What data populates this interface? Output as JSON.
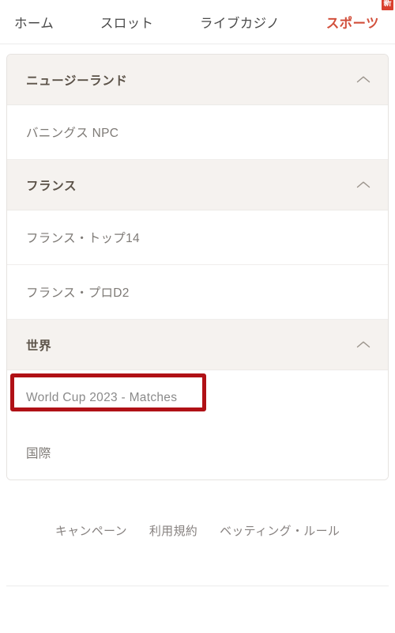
{
  "nav": {
    "items": [
      {
        "label": "ホーム",
        "active": false,
        "badge": null
      },
      {
        "label": "スロット",
        "active": false,
        "badge": null
      },
      {
        "label": "ライブカジノ",
        "active": false,
        "badge": null
      },
      {
        "label": "スポーツ",
        "active": true,
        "badge": "新"
      }
    ]
  },
  "colors": {
    "accent": "#d2503c",
    "badge": "#d9402e",
    "highlight": "#b01116",
    "header_bg": "#f5f2ef",
    "text_muted": "#7e7a76"
  },
  "sections": [
    {
      "title": "ニュージーランド",
      "toggle_icon": "chevron-up-icon",
      "leagues": [
        {
          "label": "バニングス NPC",
          "highlighted": false
        }
      ]
    },
    {
      "title": "フランス",
      "toggle_icon": "chevron-up-icon",
      "leagues": [
        {
          "label": "フランス・トップ14",
          "highlighted": false
        },
        {
          "label": "フランス・プロD2",
          "highlighted": false
        }
      ]
    },
    {
      "title": "世界",
      "toggle_icon": "chevron-up-icon",
      "leagues": [
        {
          "label": "World Cup 2023 - Matches",
          "highlighted": true
        },
        {
          "label": "国際",
          "highlighted": false
        }
      ]
    }
  ],
  "footer": {
    "links": [
      {
        "label": "キャンペーン"
      },
      {
        "label": "利用規約"
      },
      {
        "label": "ベッティング・ルール"
      }
    ]
  }
}
